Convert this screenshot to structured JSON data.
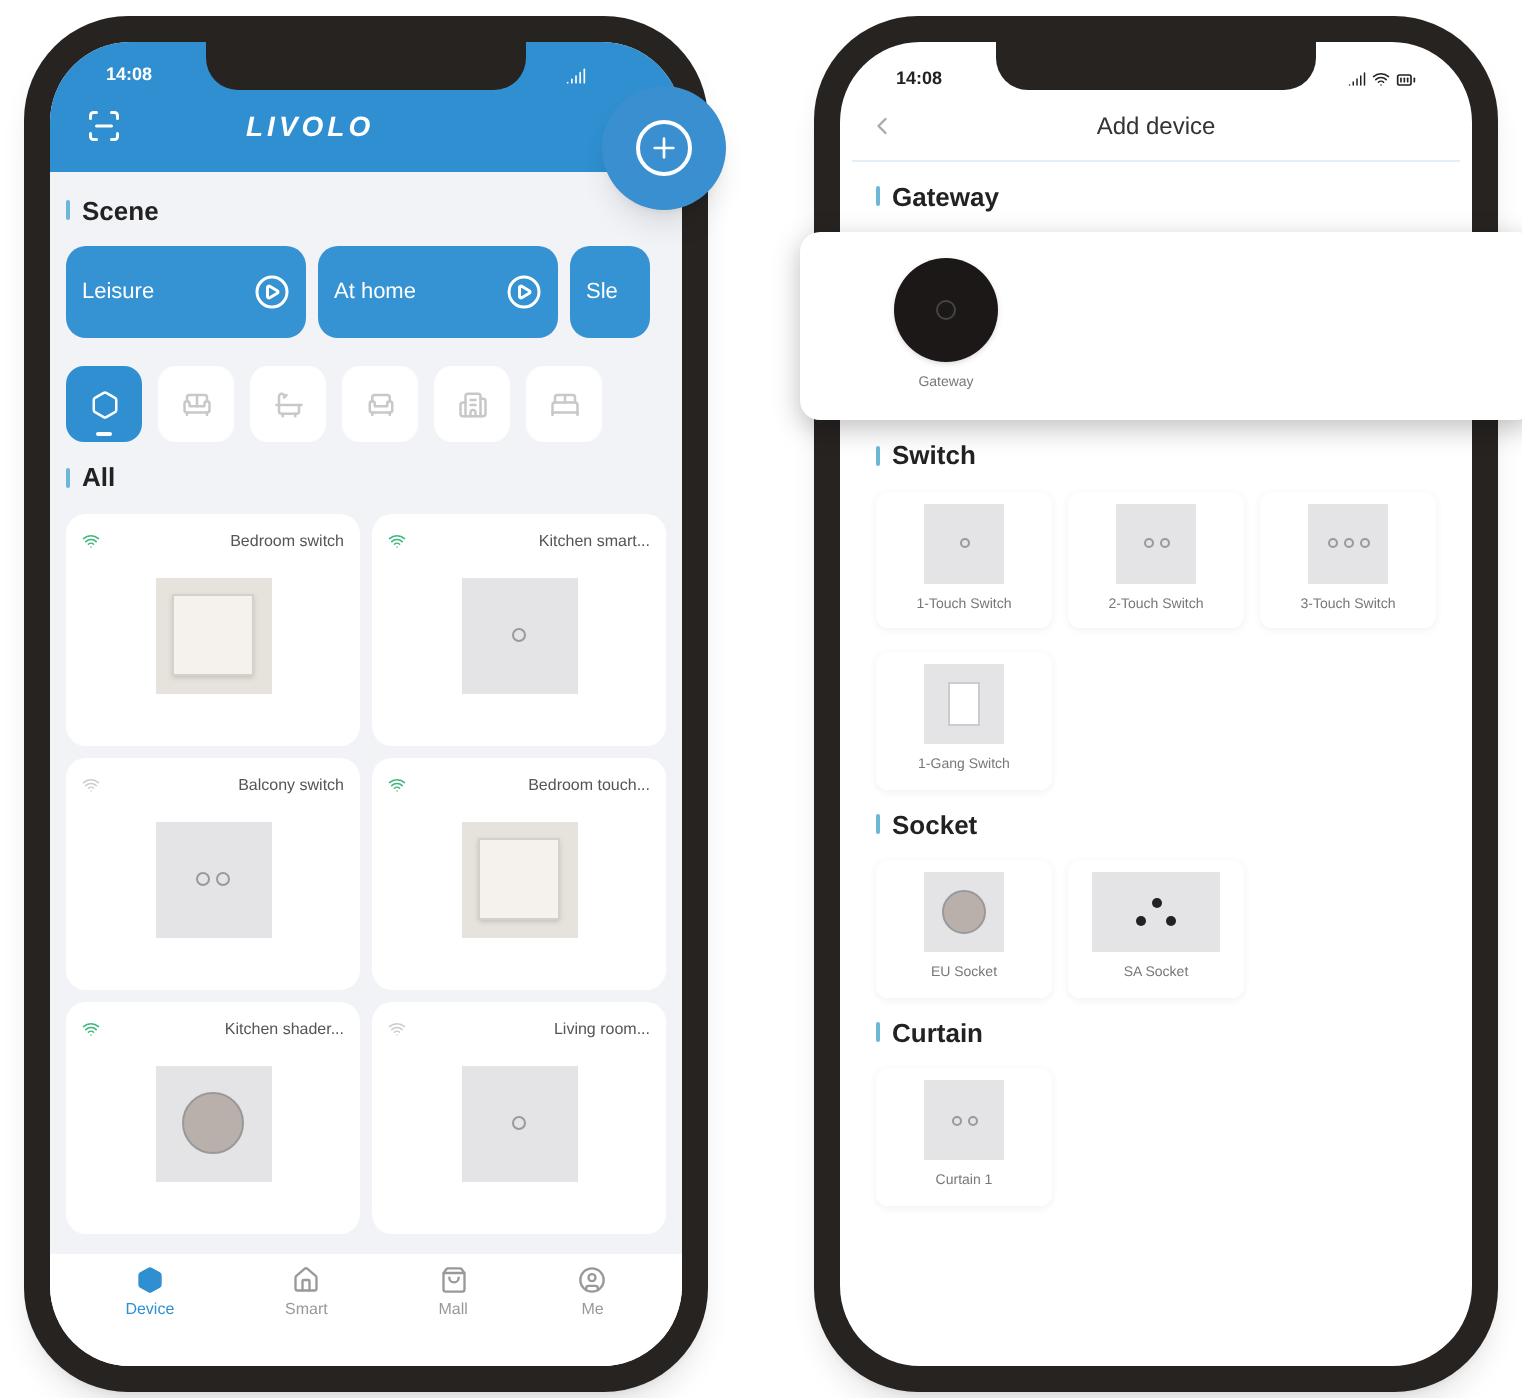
{
  "home_screen": {
    "status_bar": {
      "time": "14:08"
    },
    "logo": "LIVOLO",
    "scene_heading": "Scene",
    "scenes": [
      "Leisure",
      "At home",
      "Sle"
    ],
    "categories": [
      {
        "selected": true
      },
      {
        "selected": false
      },
      {
        "selected": false
      },
      {
        "selected": false
      },
      {
        "selected": false
      },
      {
        "selected": false
      }
    ],
    "all_heading": "All",
    "devices": [
      {
        "name": "Bedroom switch",
        "online": true,
        "kind": "rocker"
      },
      {
        "name": "Kitchen smart...",
        "online": true,
        "kind": "touch1"
      },
      {
        "name": "Balcony switch",
        "online": false,
        "kind": "touch2"
      },
      {
        "name": "Bedroom touch...",
        "online": true,
        "kind": "rocker"
      },
      {
        "name": "Kitchen shader...",
        "online": true,
        "kind": "socket"
      },
      {
        "name": "Living room...",
        "online": false,
        "kind": "touch1"
      }
    ],
    "nav": [
      {
        "label": "Device",
        "selected": true
      },
      {
        "label": "Smart",
        "selected": false
      },
      {
        "label": "Mall",
        "selected": false
      },
      {
        "label": "Me",
        "selected": false
      }
    ]
  },
  "add_device_screen": {
    "status_bar": {
      "time": "14:08"
    },
    "title": "Add device",
    "sections": [
      {
        "heading": "Gateway",
        "popout": true,
        "items": [
          {
            "label": "Gateway",
            "kind": "gateway"
          }
        ]
      },
      {
        "heading": "Switch",
        "popout": false,
        "items": [
          {
            "label": "1-Touch Switch",
            "kind": "touch1"
          },
          {
            "label": "2-Touch Switch",
            "kind": "touch2"
          },
          {
            "label": "3-Touch Switch",
            "kind": "touch3"
          },
          {
            "label": "1-Gang Switch",
            "kind": "gang"
          }
        ]
      },
      {
        "heading": "Socket",
        "popout": false,
        "items": [
          {
            "label": "EU Socket",
            "kind": "eu"
          },
          {
            "label": "SA Socket",
            "kind": "sa"
          }
        ]
      },
      {
        "heading": "Curtain",
        "popout": false,
        "items": [
          {
            "label": "Curtain 1",
            "kind": "touch2"
          }
        ]
      }
    ]
  }
}
